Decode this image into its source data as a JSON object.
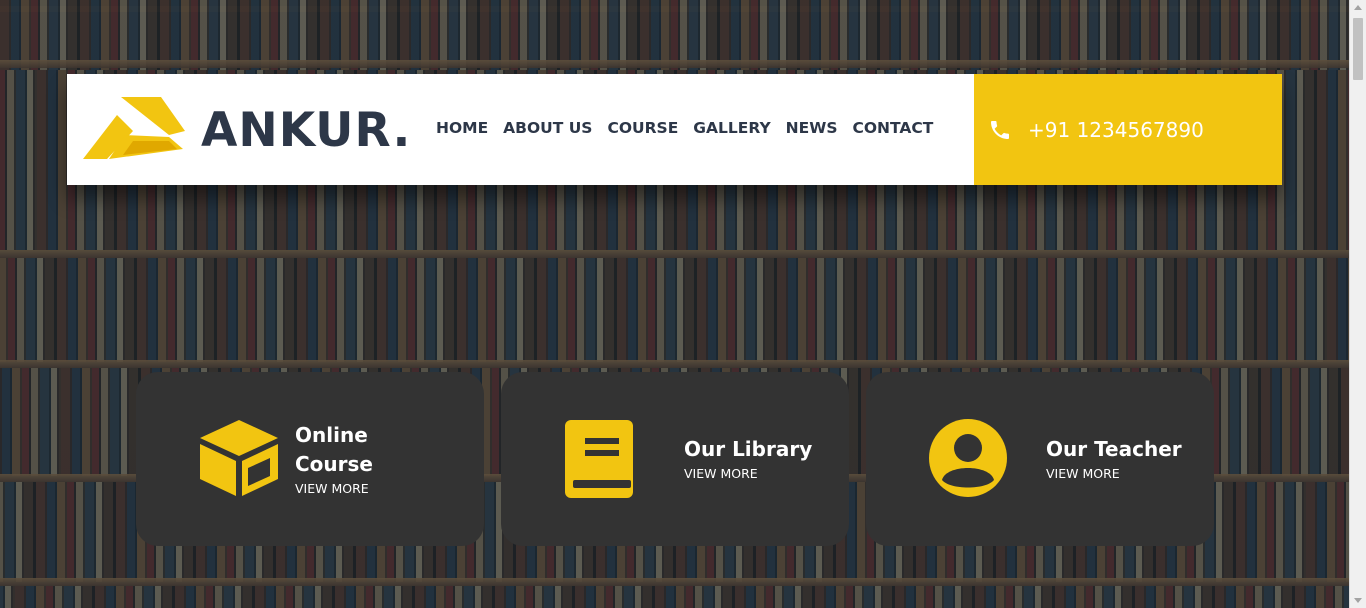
{
  "brand": {
    "name": "ANKUR.",
    "accent": "#f2c511",
    "dark": "#2d3748"
  },
  "nav": {
    "items": [
      {
        "label": "HOME"
      },
      {
        "label": "ABOUT US"
      },
      {
        "label": "COURSE"
      },
      {
        "label": "GALLERY"
      },
      {
        "label": "NEWS"
      },
      {
        "label": "CONTACT"
      }
    ]
  },
  "contact": {
    "phone": "+91 1234567890",
    "icon": "phone-icon"
  },
  "features": [
    {
      "title_line1": "Online",
      "title_line2": "Course",
      "link": "VIEW MORE",
      "icon": "box-icon"
    },
    {
      "title": "Our Library",
      "link": "VIEW MORE",
      "icon": "book-icon"
    },
    {
      "title": "Our Teacher",
      "link": "VIEW MORE",
      "icon": "user-circle-icon"
    }
  ],
  "colors": {
    "card_bg": "#333333",
    "icon_yellow": "#f2c511"
  }
}
